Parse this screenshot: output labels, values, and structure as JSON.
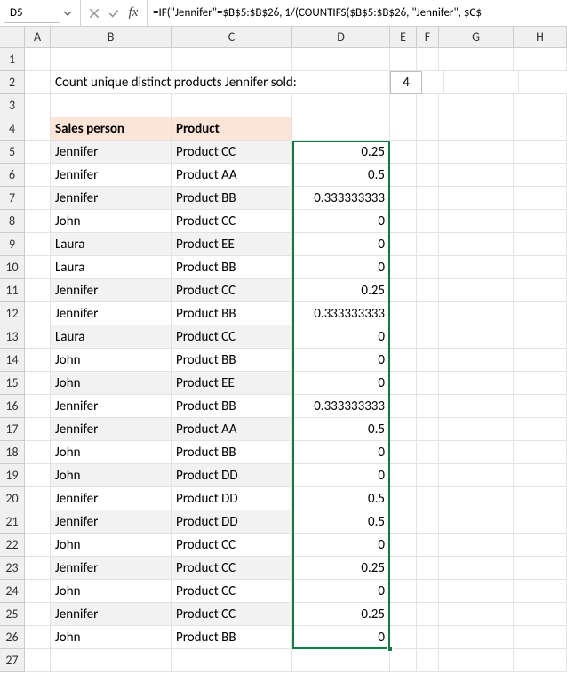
{
  "cellRef": "D5",
  "formula": "=IF(\"Jennifer\"=$B$5:$B$26, 1/(COUNTIFS($B$5:$B$26, \"Jennifer\", $C$",
  "cols": [
    "A",
    "B",
    "C",
    "D",
    "E",
    "F",
    "G",
    "H"
  ],
  "rowCount": 27,
  "title": "Count unique distinct products  Jennifer sold:",
  "count": "4",
  "headers": {
    "b": "Sales person",
    "c": "Product"
  },
  "data": [
    {
      "b": "Jennifer",
      "c": "Product CC",
      "d": "0.25"
    },
    {
      "b": "Jennifer",
      "c": "Product AA",
      "d": "0.5"
    },
    {
      "b": "Jennifer",
      "c": "Product BB",
      "d": "0.333333333"
    },
    {
      "b": "John",
      "c": "Product CC",
      "d": "0"
    },
    {
      "b": "Laura",
      "c": "Product EE",
      "d": "0"
    },
    {
      "b": "Laura",
      "c": "Product BB",
      "d": "0"
    },
    {
      "b": "Jennifer",
      "c": "Product CC",
      "d": "0.25"
    },
    {
      "b": "Jennifer",
      "c": "Product BB",
      "d": "0.333333333"
    },
    {
      "b": "Laura",
      "c": "Product CC",
      "d": "0"
    },
    {
      "b": "John",
      "c": "Product BB",
      "d": "0"
    },
    {
      "b": "John",
      "c": "Product EE",
      "d": "0"
    },
    {
      "b": "Jennifer",
      "c": "Product BB",
      "d": "0.333333333"
    },
    {
      "b": "Jennifer",
      "c": "Product AA",
      "d": "0.5"
    },
    {
      "b": "John",
      "c": "Product BB",
      "d": "0"
    },
    {
      "b": "John",
      "c": "Product DD",
      "d": "0"
    },
    {
      "b": "Jennifer",
      "c": "Product DD",
      "d": "0.5"
    },
    {
      "b": "Jennifer",
      "c": "Product DD",
      "d": "0.5"
    },
    {
      "b": "John",
      "c": "Product CC",
      "d": "0"
    },
    {
      "b": "Jennifer",
      "c": "Product CC",
      "d": "0.25"
    },
    {
      "b": "John",
      "c": "Product CC",
      "d": "0"
    },
    {
      "b": "Jennifer",
      "c": "Product CC",
      "d": "0.25"
    },
    {
      "b": "John",
      "c": "Product BB",
      "d": "0"
    }
  ]
}
